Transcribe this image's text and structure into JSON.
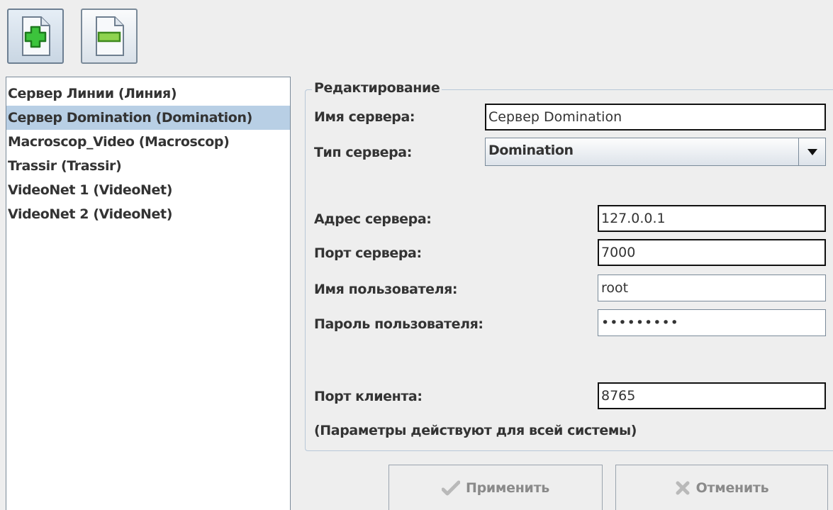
{
  "toolbar": {
    "add_icon": "add-document-icon",
    "remove_icon": "remove-document-icon"
  },
  "server_list": {
    "items": [
      "Сервер Линии (Линия)",
      "Сервер Domination (Domination)",
      "Macroscop_Video (Macroscop)",
      "Trassir (Trassir)",
      "VideoNet 1 (VideoNet)",
      "VideoNet 2 (VideoNet)"
    ],
    "selected_index": 1
  },
  "editor": {
    "title": "Редактирование",
    "server_name_label": "Имя сервера:",
    "server_name_value": "Сервер Domination",
    "server_type_label": "Тип сервера:",
    "server_type_value": "Domination",
    "address_label": "Адрес сервера:",
    "address_value": "127.0.0.1",
    "port_label": "Порт сервера:",
    "port_value": "7000",
    "user_label": "Имя пользователя:",
    "user_value": "root",
    "password_label": "Пароль пользователя:",
    "password_value": "•••••••••",
    "client_port_label": "Порт клиента:",
    "client_port_value": "8765",
    "note": "(Параметры действуют для всей системы)"
  },
  "actions": {
    "apply_label": "Применить",
    "cancel_label": "Отменить"
  },
  "colors": {
    "selection": "#b8cfe5",
    "add_green": "#3cc43c",
    "remove_green": "#8fd34f",
    "disabled_text": "#8a8a8a"
  }
}
